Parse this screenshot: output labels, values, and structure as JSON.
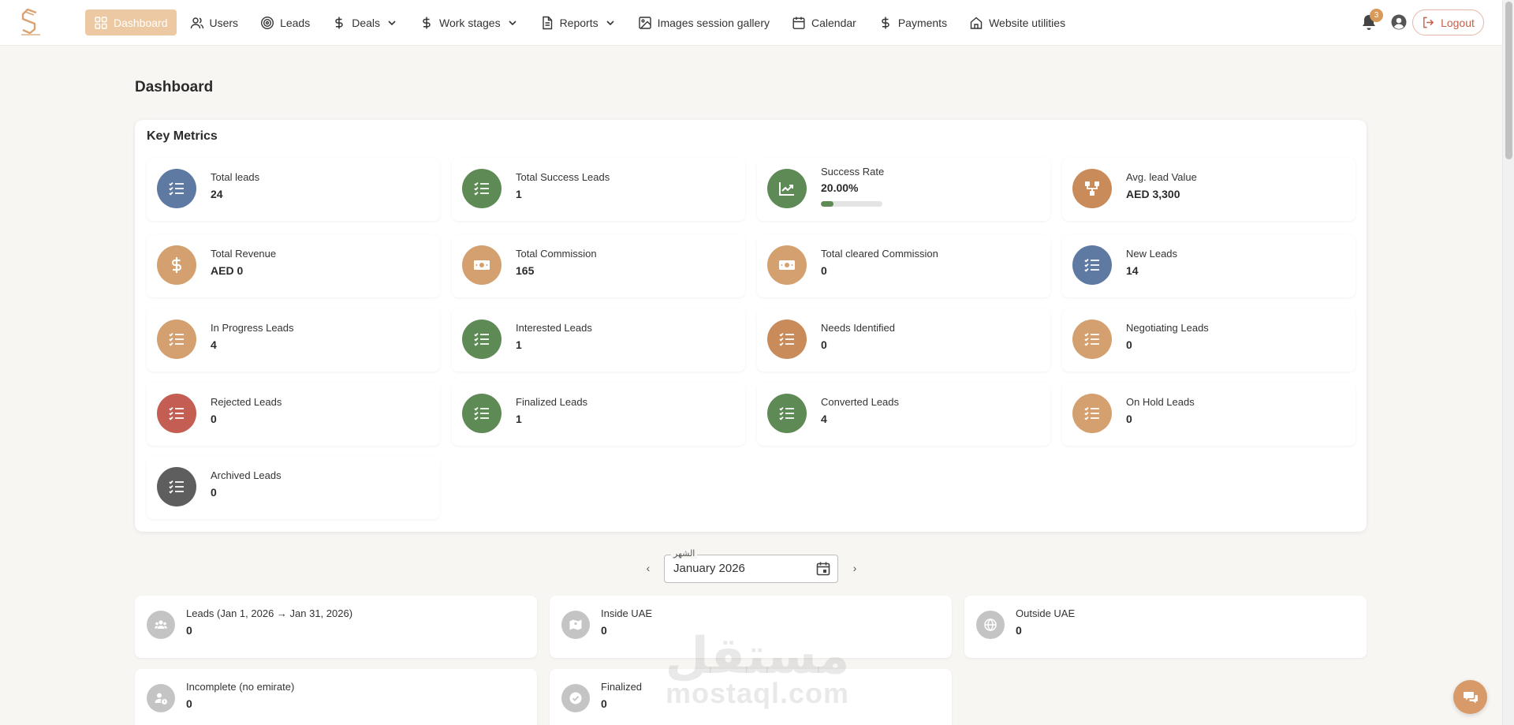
{
  "brand": {
    "logo_icon": "s-logo-icon"
  },
  "nav": {
    "items": [
      {
        "label": "Dashboard",
        "icon": "grid-icon",
        "active": true
      },
      {
        "label": "Users",
        "icon": "users-icon"
      },
      {
        "label": "Leads",
        "icon": "target-icon"
      },
      {
        "label": "Deals",
        "icon": "dollar-icon",
        "dropdown": true
      },
      {
        "label": "Work stages",
        "icon": "dollar-icon",
        "dropdown": true
      },
      {
        "label": "Reports",
        "icon": "document-icon",
        "dropdown": true
      },
      {
        "label": "Images session gallery",
        "icon": "image-icon"
      },
      {
        "label": "Calendar",
        "icon": "calendar-icon"
      },
      {
        "label": "Payments",
        "icon": "dollar-icon"
      },
      {
        "label": "Website utilities",
        "icon": "home-icon"
      }
    ]
  },
  "header": {
    "notifications_count": "3",
    "logout_label": "Logout"
  },
  "page": {
    "title": "Dashboard"
  },
  "key_metrics": {
    "title": "Key Metrics",
    "items": [
      {
        "label": "Total leads",
        "value": "24",
        "color": "#5e7aa3",
        "icon": "checklist-icon"
      },
      {
        "label": "Total Success Leads",
        "value": "1",
        "color": "#5e8a56",
        "icon": "checklist-icon"
      },
      {
        "label": "Success Rate",
        "value": "20.00%",
        "color": "#5e8a56",
        "icon": "trend-chart-icon",
        "progress": 0.2
      },
      {
        "label": "Avg. lead Value",
        "value": "AED 3,300",
        "color": "#c98b5a",
        "icon": "hierarchy-icon"
      },
      {
        "label": "Total Revenue",
        "value": "AED 0",
        "color": "#d4a070",
        "icon": "dollar-icon"
      },
      {
        "label": "Total Commission",
        "value": "165",
        "color": "#d4a070",
        "icon": "cash-icon"
      },
      {
        "label": "Total cleared Commission",
        "value": "0",
        "color": "#d4a070",
        "icon": "cash-icon"
      },
      {
        "label": "New Leads",
        "value": "14",
        "color": "#5e7aa3",
        "icon": "checklist-icon"
      },
      {
        "label": "In Progress Leads",
        "value": "4",
        "color": "#d4a070",
        "icon": "checklist-icon"
      },
      {
        "label": "Interested Leads",
        "value": "1",
        "color": "#5e8a56",
        "icon": "checklist-icon"
      },
      {
        "label": "Needs Identified",
        "value": "0",
        "color": "#c98b5a",
        "icon": "checklist-icon"
      },
      {
        "label": "Negotiating Leads",
        "value": "0",
        "color": "#d4a070",
        "icon": "checklist-icon"
      },
      {
        "label": "Rejected Leads",
        "value": "0",
        "color": "#c45e52",
        "icon": "checklist-icon"
      },
      {
        "label": "Finalized Leads",
        "value": "1",
        "color": "#5e8a56",
        "icon": "checklist-icon"
      },
      {
        "label": "Converted Leads",
        "value": "4",
        "color": "#5e8a56",
        "icon": "checklist-icon"
      },
      {
        "label": "On Hold Leads",
        "value": "0",
        "color": "#d4a070",
        "icon": "checklist-icon"
      },
      {
        "label": "Archived Leads",
        "value": "0",
        "color": "#5e5e5e",
        "icon": "checklist-icon"
      }
    ]
  },
  "month_picker": {
    "label": "الشهر",
    "value": "January 2026",
    "prev_icon": "chevron-left-icon",
    "next_icon": "chevron-right-icon"
  },
  "monthly_stats": [
    {
      "label": "Leads (Jan 1, 2026 → Jan 31, 2026)",
      "value": "0",
      "icon": "group-icon"
    },
    {
      "label": "Inside UAE",
      "value": "0",
      "icon": "map-icon"
    },
    {
      "label": "Outside UAE",
      "value": "0",
      "icon": "globe-icon"
    },
    {
      "label": "Incomplete (no emirate)",
      "value": "0",
      "icon": "user-clock-icon"
    },
    {
      "label": "Finalized",
      "value": "0",
      "icon": "check-circle-icon"
    }
  ],
  "watermark": {
    "arabic": "مستقل",
    "english": "mostaql.com"
  },
  "chat": {
    "icon": "chat-icon"
  }
}
